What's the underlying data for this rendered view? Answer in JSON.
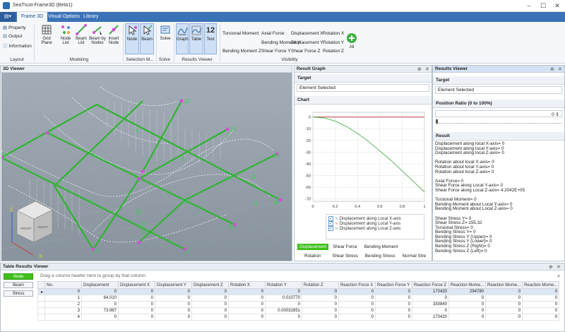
{
  "window": {
    "title": "SeaTrust-Frame3D (Beta1)"
  },
  "tabs": {
    "file": "",
    "frame3d": "Frame 3D",
    "visual_options": "Visual Options",
    "library": "Library"
  },
  "ribbon": {
    "layout": {
      "property": "Property",
      "output": "Output",
      "information": "Information",
      "label": "Layout"
    },
    "modeling": {
      "grid_plane": "Grid Plane",
      "node_list": "Node List",
      "beam_list": "Beam List",
      "beam_by_nodes": "Beam by Nodes",
      "insert_node": "Insert Node",
      "label": "Modeling"
    },
    "selection": {
      "node": "Node",
      "beam": "Beam",
      "label": "Selection M..."
    },
    "solve": {
      "solve": "Solve",
      "label": "Solve"
    },
    "results_viewer": {
      "graph": "Graph",
      "table": "Table",
      "text": "Text",
      "label": "Results Viewer"
    },
    "visibility": {
      "col1": [
        "Torsional Moment",
        "Bending Moment Z"
      ],
      "col2": [
        "Axial Force",
        "Bending Moment Y"
      ],
      "col3": [
        "",
        "Shear Force Y"
      ],
      "col4": [
        "Displacement X",
        "Displacement Y"
      ],
      "col4b": [
        "Shear Force Z",
        "Displacement Z"
      ],
      "col5": [
        "Rotation X",
        "Rotation Y",
        "Rotation Z"
      ],
      "all": "All",
      "label": "Visibility"
    }
  },
  "viewer3d": {
    "title": "3D Viewer",
    "node_labels": [
      "10",
      "15",
      "20",
      "19",
      "18",
      "17",
      "16",
      "11",
      "12",
      "13",
      "14",
      "5",
      "6",
      "7",
      "8",
      "9",
      "2",
      "3",
      "4",
      "1",
      "0",
      "21"
    ],
    "cube_labels": {
      "z": "Z",
      "x": "X",
      "front": "FRONT",
      "right": "RIGHT"
    }
  },
  "result_graph": {
    "title": "Result Graph",
    "target_label": "Target",
    "target_value": "Element Selected",
    "chart_label": "Chart",
    "legend": [
      "Displacement along Local X-axis",
      "Displacement along Local Y-axis",
      "Displacement along Local Z-axis"
    ],
    "buttons_row1": [
      "Displacement",
      "Shear Force",
      "Bending Moment"
    ],
    "buttons_row2": [
      "Rotation",
      "Shear Stress",
      "Bending Stress",
      "Normal Stre"
    ]
  },
  "chart_data": {
    "type": "line",
    "x": [
      0,
      0.1,
      0.2,
      0.3,
      0.4,
      0.5,
      0.6,
      0.7,
      0.8,
      0.9,
      1.0
    ],
    "series": [
      {
        "name": "Displacement along Local X-axis",
        "color": "#4a90d9",
        "values": [
          0,
          0,
          0,
          0,
          0,
          0,
          0,
          0,
          0,
          0,
          0
        ]
      },
      {
        "name": "Displacement along Local Y-axis",
        "color": "#d9534f",
        "values": [
          0,
          0,
          0,
          0,
          0,
          0,
          0,
          0,
          0,
          0,
          0
        ]
      },
      {
        "name": "Displacement along Local Z-axis",
        "color": "#4cae4c",
        "values": [
          0,
          -0.8,
          -3.5,
          -8,
          -14,
          -21,
          -29,
          -37,
          -46,
          -55,
          -64
        ]
      }
    ],
    "xticks": [
      0,
      0.2,
      0.4,
      0.6,
      0.8,
      1
    ],
    "yticks": [
      0,
      -10,
      -20,
      -30,
      -40,
      -50,
      -60,
      -70
    ],
    "ylim": [
      -72,
      4
    ],
    "xlim": [
      0,
      1
    ],
    "grid": true
  },
  "results_viewer": {
    "title": "Results Viewer",
    "target_label": "Target",
    "target_value": "Element Selected",
    "position_label": "Position Ratio (0 to 100%)",
    "position_value": "0",
    "result_label": "Result",
    "lines": [
      "Displacement along local X-axis= 0",
      "Displacement along local Y-axis= 0",
      "Displacement along local Z-axis= 0",
      "",
      "Rotation about local X-axis= 0",
      "Rotation about local Y-axis= 0",
      "Rotation about local Z-axis= 0",
      "",
      "Axial Force= 0",
      "Shear Force along Local Y-axis= 0",
      "Shear Force along Local Z-axis= 4.2042E+05",
      "",
      "Torsional Moment= 0",
      "Bending Moment about Local Y-axis= 0",
      "Bending Moment about Local Z-axis= 0",
      "",
      "Shear Stress Y= 0",
      "Shear Stress Z= 155.32",
      "Torsional Stress= 0",
      "Bending Stress Y= 0",
      "Bending Stress Y (Upper)= 0",
      "Bending Stress Y (Lower)= 0",
      "Bending Stress Z (Right)= 0",
      "Bending Stress Z (Left)= 0"
    ]
  },
  "table_viewer": {
    "title": "Table Results Viewer",
    "group_hint": "Drag a column header here to group by that column",
    "side_buttons": [
      "Node",
      "Beam",
      "Stress"
    ],
    "columns": [
      "No.",
      "Displacement",
      "Displacement X",
      "Displacement Y",
      "Displacement Z",
      "Rotation X",
      "Rotation Y",
      "Rotation Z",
      "Reaction Force X",
      "Reaction Force Y",
      "Reaction Force Z",
      "Reaction Mome...",
      "Reaction Mome...",
      "Reaction Mome..."
    ],
    "rows": [
      [
        "0",
        "0",
        "0",
        "0",
        "0",
        "0",
        "0",
        "0",
        "0",
        "0",
        "170420",
        "294780",
        "0",
        "0"
      ],
      [
        "1",
        "64.010",
        "0",
        "0",
        "0",
        "0",
        "0.010770",
        "0",
        "0",
        "0",
        "0",
        "0",
        "0",
        "0"
      ],
      [
        "2",
        "0",
        "0",
        "0",
        "0",
        "0",
        "0",
        "0",
        "0",
        "0",
        "330840",
        "0",
        "0",
        "0"
      ],
      [
        "3",
        "73.967",
        "0",
        "0",
        "0",
        "0",
        "0.00032851",
        "0",
        "0",
        "0",
        "0",
        "0",
        "0",
        "0"
      ],
      [
        "4",
        "0",
        "0",
        "0",
        "0",
        "0",
        "0",
        "0",
        "0",
        "0",
        "170420",
        "0",
        "0",
        "0"
      ]
    ]
  }
}
